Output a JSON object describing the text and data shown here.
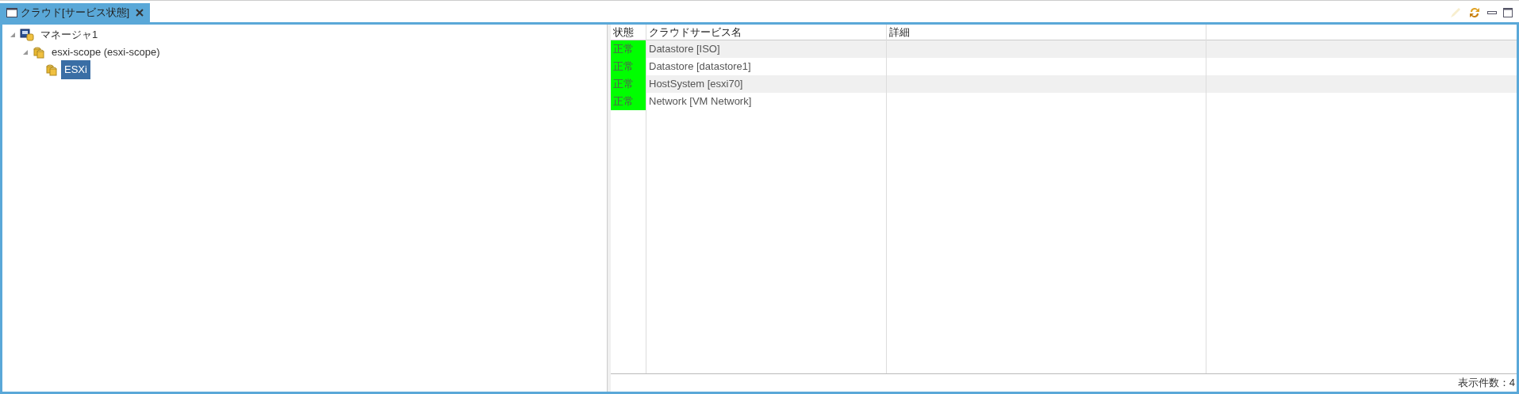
{
  "tab": {
    "title": "クラウド[サービス状態]",
    "selected": true
  },
  "tree": [
    {
      "label": "マネージャ1",
      "kind": "manager",
      "expanded": true,
      "selected": false,
      "children": [
        {
          "label": "esxi-scope (esxi-scope)",
          "kind": "scope",
          "expanded": true,
          "selected": false,
          "children": [
            {
              "label": "ESXi",
              "kind": "scope",
              "selected": true
            }
          ]
        }
      ]
    }
  ],
  "table": {
    "columns": [
      "状態",
      "クラウドサービス名",
      "詳細"
    ],
    "rows": [
      {
        "status": "正常",
        "color": "#00ff00",
        "name": "Datastore [ISO]"
      },
      {
        "status": "正常",
        "color": "#00ff00",
        "name": "Datastore [datastore1]"
      },
      {
        "status": "正常",
        "color": "#00ff00",
        "name": "HostSystem [esxi70]"
      },
      {
        "status": "正常",
        "color": "#00ff00",
        "name": "Network [VM Network]"
      }
    ]
  },
  "toolbar": {
    "edit_disabled": true
  },
  "footer": "表示件数：4"
}
